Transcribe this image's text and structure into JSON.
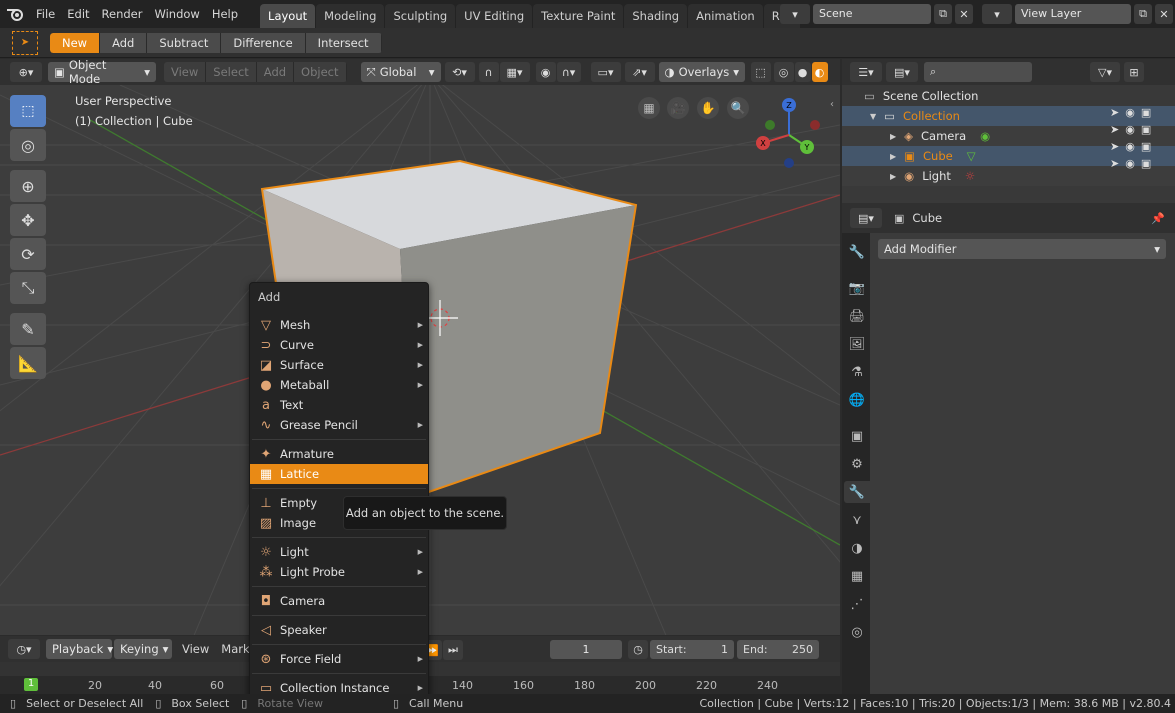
{
  "topbar": {
    "menus": [
      "File",
      "Edit",
      "Render",
      "Window",
      "Help"
    ],
    "workspaces": [
      "Layout",
      "Modeling",
      "Sculpting",
      "UV Editing",
      "Texture Paint",
      "Shading",
      "Animation",
      "Rende"
    ],
    "active_workspace": "Layout",
    "scene": "Scene",
    "view_layer": "View Layer"
  },
  "tool_header": {
    "modes": [
      "New",
      "Add",
      "Subtract",
      "Difference",
      "Intersect"
    ],
    "active": "New"
  },
  "viewport_header": {
    "mode": "Object Mode",
    "menus": [
      "View",
      "Select",
      "Add",
      "Object"
    ],
    "orientation": "Global",
    "overlays": "Overlays"
  },
  "viewport": {
    "perspective": "User Perspective",
    "collection_info": "(1) Collection | Cube",
    "gizmo": {
      "x": "X",
      "y": "Y",
      "z": "Z"
    }
  },
  "add_menu": {
    "title": "Add",
    "items": [
      {
        "label": "Mesh",
        "icon": "mesh-icon",
        "sub": true
      },
      {
        "label": "Curve",
        "icon": "curve-icon",
        "sub": true
      },
      {
        "label": "Surface",
        "icon": "surface-icon",
        "sub": true
      },
      {
        "label": "Metaball",
        "icon": "metaball-icon",
        "sub": true
      },
      {
        "label": "Text",
        "icon": "text-icon",
        "sub": false
      },
      {
        "label": "Grease Pencil",
        "icon": "grease-pencil-icon",
        "sub": true
      },
      {
        "label": "Armature",
        "icon": "armature-icon",
        "sub": false
      },
      {
        "label": "Lattice",
        "icon": "lattice-icon",
        "sub": false
      },
      {
        "label": "Empty",
        "icon": "empty-icon",
        "sub": true
      },
      {
        "label": "Image",
        "icon": "image-icon",
        "sub": true
      },
      {
        "label": "Light",
        "icon": "light-icon",
        "sub": true
      },
      {
        "label": "Light Probe",
        "icon": "light-probe-icon",
        "sub": true
      },
      {
        "label": "Camera",
        "icon": "camera-icon",
        "sub": false
      },
      {
        "label": "Speaker",
        "icon": "speaker-icon",
        "sub": false
      },
      {
        "label": "Force Field",
        "icon": "force-field-icon",
        "sub": true
      },
      {
        "label": "Collection Instance",
        "icon": "collection-instance-icon",
        "sub": true
      }
    ],
    "highlighted": "Lattice",
    "tooltip": "Add an object to the scene."
  },
  "timeline": {
    "menus": [
      "Playback",
      "Keying",
      "View",
      "Marke"
    ],
    "current_frame": "1",
    "start_label": "Start:",
    "start": "1",
    "end_label": "End:",
    "end": "250",
    "ticks": [
      "1",
      "20",
      "40",
      "60",
      "140",
      "160",
      "180",
      "200",
      "220",
      "240"
    ]
  },
  "outliner": {
    "root": "Scene Collection",
    "collection": "Collection",
    "objects": [
      "Camera",
      "Cube",
      "Light"
    ]
  },
  "properties": {
    "object_name": "Cube",
    "add_modifier": "Add Modifier"
  },
  "statusbar": {
    "select": "Select or Deselect All",
    "box": "Box Select",
    "rotate": "Rotate View",
    "call_menu": "Call Menu",
    "stats": "Collection | Cube | Verts:12 | Faces:10 | Tris:20 | Objects:1/3 | Mem: 38.6 MB | v2.80.4"
  },
  "colors": {
    "accent": "#e98a15",
    "select": "#5680c2"
  }
}
